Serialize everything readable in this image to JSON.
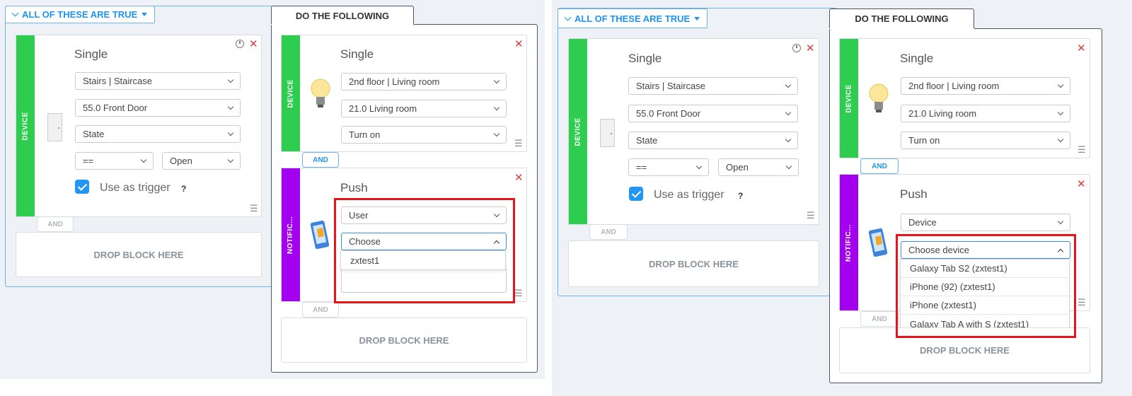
{
  "left": {
    "conditions_header": "ALL OF THESE ARE TRUE",
    "actions_header": "DO THE FOLLOWING",
    "condition_block": {
      "strip_label": "DEVICE",
      "title": "Single",
      "room": "Stairs | Staircase",
      "device": "55.0 Front Door",
      "property": "State",
      "operator": "==",
      "value": "Open",
      "trigger_label": "Use as trigger",
      "help": "?"
    },
    "cond_and": "AND",
    "cond_drop": "DROP BLOCK HERE",
    "device_action": {
      "strip_label": "DEVICE",
      "title": "Single",
      "room": "2nd floor | Living room",
      "device": "21.0 Living room",
      "action": "Turn on"
    },
    "action_and": "AND",
    "notification_action": {
      "strip_label": "NOTIFIC...",
      "title": "Push",
      "target_type": "User",
      "choose": "Choose",
      "options": [
        "zxtest1"
      ]
    },
    "notif_and": "AND",
    "action_drop": "DROP BLOCK HERE"
  },
  "right": {
    "conditions_header": "ALL OF THESE ARE TRUE",
    "actions_header": "DO THE FOLLOWING",
    "condition_block": {
      "strip_label": "DEVICE",
      "title": "Single",
      "room": "Stairs | Staircase",
      "device": "55.0 Front Door",
      "property": "State",
      "operator": "==",
      "value": "Open",
      "trigger_label": "Use as trigger",
      "help": "?"
    },
    "cond_and": "AND",
    "cond_drop": "DROP BLOCK HERE",
    "device_action": {
      "strip_label": "DEVICE",
      "title": "Single",
      "room": "2nd floor | Living room",
      "device": "21.0 Living room",
      "action": "Turn on"
    },
    "action_and": "AND",
    "notification_action": {
      "strip_label": "NOTIFIC...",
      "title": "Push",
      "target_type": "Device",
      "choose": "Choose device",
      "options": [
        "Galaxy Tab S2 (zxtest1)",
        "iPhone (92) (zxtest1)",
        "iPhone (zxtest1)",
        "Galaxy Tab A with S (zxtest1)"
      ]
    },
    "notif_and": "AND",
    "action_drop": "DROP BLOCK HERE"
  },
  "colors": {
    "device_strip": "#2ecc4f",
    "notification_strip": "#a300f0",
    "accent": "#1e93f0",
    "highlight": "#e8141b"
  }
}
